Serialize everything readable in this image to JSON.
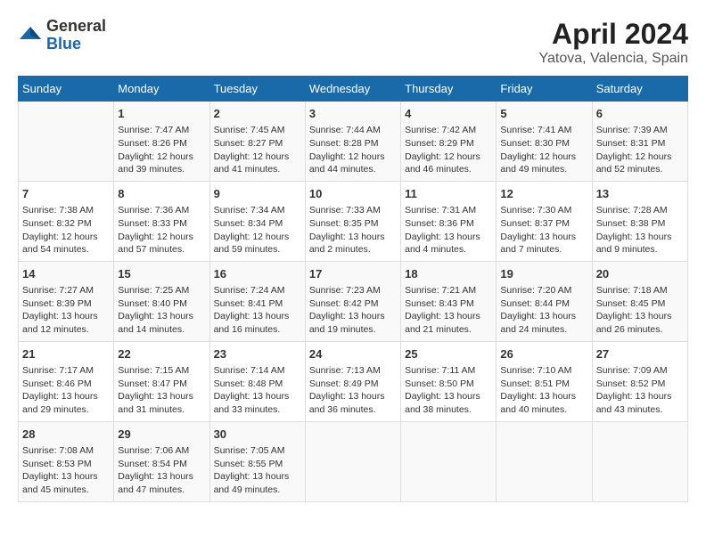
{
  "header": {
    "logo_general": "General",
    "logo_blue": "Blue",
    "title": "April 2024",
    "subtitle": "Yatova, Valencia, Spain"
  },
  "columns": [
    "Sunday",
    "Monday",
    "Tuesday",
    "Wednesday",
    "Thursday",
    "Friday",
    "Saturday"
  ],
  "weeks": [
    [
      {
        "day": "",
        "sunrise": "",
        "sunset": "",
        "daylight": ""
      },
      {
        "day": "1",
        "sunrise": "Sunrise: 7:47 AM",
        "sunset": "Sunset: 8:26 PM",
        "daylight": "Daylight: 12 hours and 39 minutes."
      },
      {
        "day": "2",
        "sunrise": "Sunrise: 7:45 AM",
        "sunset": "Sunset: 8:27 PM",
        "daylight": "Daylight: 12 hours and 41 minutes."
      },
      {
        "day": "3",
        "sunrise": "Sunrise: 7:44 AM",
        "sunset": "Sunset: 8:28 PM",
        "daylight": "Daylight: 12 hours and 44 minutes."
      },
      {
        "day": "4",
        "sunrise": "Sunrise: 7:42 AM",
        "sunset": "Sunset: 8:29 PM",
        "daylight": "Daylight: 12 hours and 46 minutes."
      },
      {
        "day": "5",
        "sunrise": "Sunrise: 7:41 AM",
        "sunset": "Sunset: 8:30 PM",
        "daylight": "Daylight: 12 hours and 49 minutes."
      },
      {
        "day": "6",
        "sunrise": "Sunrise: 7:39 AM",
        "sunset": "Sunset: 8:31 PM",
        "daylight": "Daylight: 12 hours and 52 minutes."
      }
    ],
    [
      {
        "day": "7",
        "sunrise": "Sunrise: 7:38 AM",
        "sunset": "Sunset: 8:32 PM",
        "daylight": "Daylight: 12 hours and 54 minutes."
      },
      {
        "day": "8",
        "sunrise": "Sunrise: 7:36 AM",
        "sunset": "Sunset: 8:33 PM",
        "daylight": "Daylight: 12 hours and 57 minutes."
      },
      {
        "day": "9",
        "sunrise": "Sunrise: 7:34 AM",
        "sunset": "Sunset: 8:34 PM",
        "daylight": "Daylight: 12 hours and 59 minutes."
      },
      {
        "day": "10",
        "sunrise": "Sunrise: 7:33 AM",
        "sunset": "Sunset: 8:35 PM",
        "daylight": "Daylight: 13 hours and 2 minutes."
      },
      {
        "day": "11",
        "sunrise": "Sunrise: 7:31 AM",
        "sunset": "Sunset: 8:36 PM",
        "daylight": "Daylight: 13 hours and 4 minutes."
      },
      {
        "day": "12",
        "sunrise": "Sunrise: 7:30 AM",
        "sunset": "Sunset: 8:37 PM",
        "daylight": "Daylight: 13 hours and 7 minutes."
      },
      {
        "day": "13",
        "sunrise": "Sunrise: 7:28 AM",
        "sunset": "Sunset: 8:38 PM",
        "daylight": "Daylight: 13 hours and 9 minutes."
      }
    ],
    [
      {
        "day": "14",
        "sunrise": "Sunrise: 7:27 AM",
        "sunset": "Sunset: 8:39 PM",
        "daylight": "Daylight: 13 hours and 12 minutes."
      },
      {
        "day": "15",
        "sunrise": "Sunrise: 7:25 AM",
        "sunset": "Sunset: 8:40 PM",
        "daylight": "Daylight: 13 hours and 14 minutes."
      },
      {
        "day": "16",
        "sunrise": "Sunrise: 7:24 AM",
        "sunset": "Sunset: 8:41 PM",
        "daylight": "Daylight: 13 hours and 16 minutes."
      },
      {
        "day": "17",
        "sunrise": "Sunrise: 7:23 AM",
        "sunset": "Sunset: 8:42 PM",
        "daylight": "Daylight: 13 hours and 19 minutes."
      },
      {
        "day": "18",
        "sunrise": "Sunrise: 7:21 AM",
        "sunset": "Sunset: 8:43 PM",
        "daylight": "Daylight: 13 hours and 21 minutes."
      },
      {
        "day": "19",
        "sunrise": "Sunrise: 7:20 AM",
        "sunset": "Sunset: 8:44 PM",
        "daylight": "Daylight: 13 hours and 24 minutes."
      },
      {
        "day": "20",
        "sunrise": "Sunrise: 7:18 AM",
        "sunset": "Sunset: 8:45 PM",
        "daylight": "Daylight: 13 hours and 26 minutes."
      }
    ],
    [
      {
        "day": "21",
        "sunrise": "Sunrise: 7:17 AM",
        "sunset": "Sunset: 8:46 PM",
        "daylight": "Daylight: 13 hours and 29 minutes."
      },
      {
        "day": "22",
        "sunrise": "Sunrise: 7:15 AM",
        "sunset": "Sunset: 8:47 PM",
        "daylight": "Daylight: 13 hours and 31 minutes."
      },
      {
        "day": "23",
        "sunrise": "Sunrise: 7:14 AM",
        "sunset": "Sunset: 8:48 PM",
        "daylight": "Daylight: 13 hours and 33 minutes."
      },
      {
        "day": "24",
        "sunrise": "Sunrise: 7:13 AM",
        "sunset": "Sunset: 8:49 PM",
        "daylight": "Daylight: 13 hours and 36 minutes."
      },
      {
        "day": "25",
        "sunrise": "Sunrise: 7:11 AM",
        "sunset": "Sunset: 8:50 PM",
        "daylight": "Daylight: 13 hours and 38 minutes."
      },
      {
        "day": "26",
        "sunrise": "Sunrise: 7:10 AM",
        "sunset": "Sunset: 8:51 PM",
        "daylight": "Daylight: 13 hours and 40 minutes."
      },
      {
        "day": "27",
        "sunrise": "Sunrise: 7:09 AM",
        "sunset": "Sunset: 8:52 PM",
        "daylight": "Daylight: 13 hours and 43 minutes."
      }
    ],
    [
      {
        "day": "28",
        "sunrise": "Sunrise: 7:08 AM",
        "sunset": "Sunset: 8:53 PM",
        "daylight": "Daylight: 13 hours and 45 minutes."
      },
      {
        "day": "29",
        "sunrise": "Sunrise: 7:06 AM",
        "sunset": "Sunset: 8:54 PM",
        "daylight": "Daylight: 13 hours and 47 minutes."
      },
      {
        "day": "30",
        "sunrise": "Sunrise: 7:05 AM",
        "sunset": "Sunset: 8:55 PM",
        "daylight": "Daylight: 13 hours and 49 minutes."
      },
      {
        "day": "",
        "sunrise": "",
        "sunset": "",
        "daylight": ""
      },
      {
        "day": "",
        "sunrise": "",
        "sunset": "",
        "daylight": ""
      },
      {
        "day": "",
        "sunrise": "",
        "sunset": "",
        "daylight": ""
      },
      {
        "day": "",
        "sunrise": "",
        "sunset": "",
        "daylight": ""
      }
    ]
  ]
}
